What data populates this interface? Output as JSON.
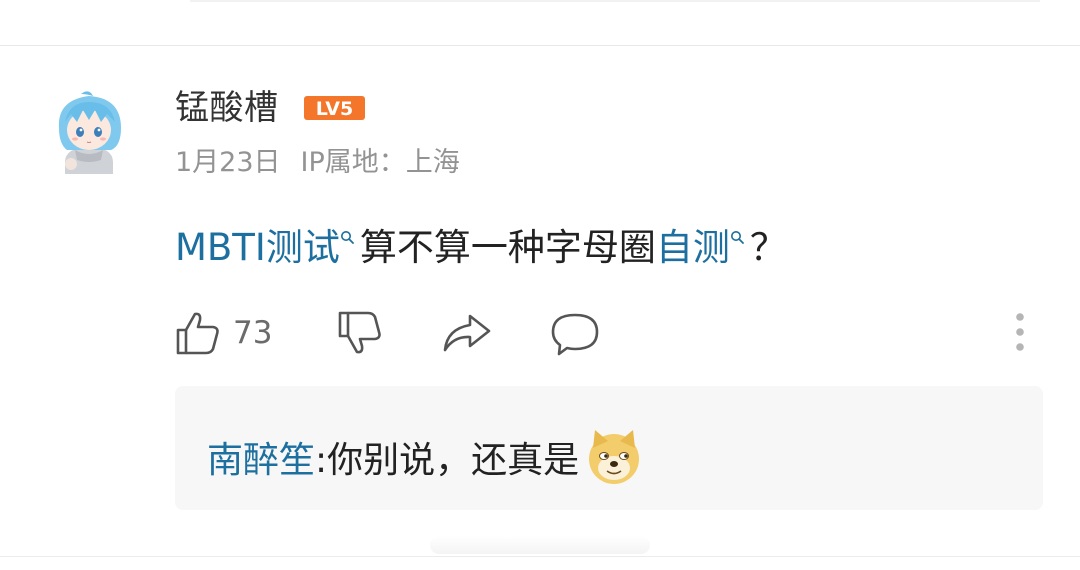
{
  "comment": {
    "username": "锰酸槽",
    "level_badge": "LV5",
    "date": "1月23日",
    "ip_location": "IP属地：上海",
    "text_parts": {
      "topic1": "MBTI测试",
      "middle": "算不算一种字母圈",
      "topic2": "自测",
      "end": "？"
    }
  },
  "actions": {
    "like_count": "73",
    "icons": [
      "thumbs-up-icon",
      "thumbs-down-icon",
      "share-icon",
      "comment-icon",
      "more-vertical-icon"
    ]
  },
  "reply": {
    "username": "南醉笙",
    "separator": ":",
    "text": "你别说，还真是",
    "emoji": "doge-icon"
  },
  "colors": {
    "link": "#1d6f9f",
    "badge": "#f3762a",
    "meta": "#939393",
    "reply_bg": "#f7f7f7"
  }
}
